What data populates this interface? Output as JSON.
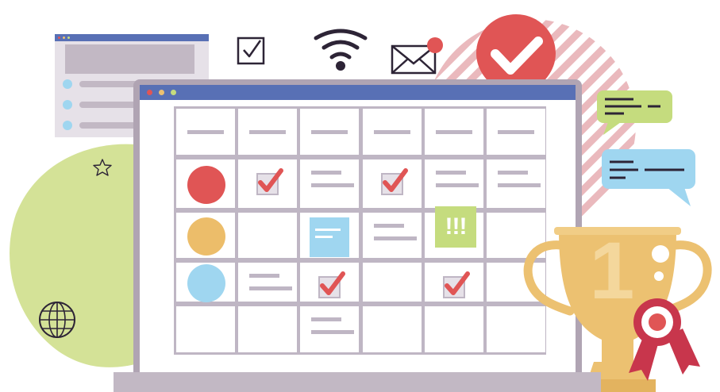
{
  "illustration": {
    "icons": [
      "checkbox-icon",
      "wifi-icon",
      "envelope-icon",
      "notification-dot",
      "location-pin-check-icon",
      "star-outline-icon",
      "globe-icon",
      "chat-bubble-green-icon",
      "chat-bubble-blue-icon",
      "trophy-icon",
      "award-ribbon-icon"
    ],
    "trophy_text": "1",
    "alert_text": "!!!",
    "colors": {
      "laptop_frame": "#b0a4b3",
      "titlebar": "#5870b5",
      "grid_lines": "#bfb6c4",
      "check_red": "#e05555",
      "sticky_blue": "#9fd6f0",
      "sticky_green": "#c5dc7e",
      "green_blob": "#d4e297",
      "stripes": "#eab9bd",
      "trophy_gold": "#ecc171",
      "dot_red": "#e05555",
      "dot_orange": "#ecbd6a",
      "dot_blue": "#9fd6f0"
    }
  },
  "calendar": {
    "header_columns": 6,
    "rows": [
      {
        "row_dot": "red",
        "cells": [
          "checked",
          "lines",
          "checked",
          "lines",
          "lines"
        ]
      },
      {
        "row_dot": "orange",
        "cells": [
          "empty",
          "sticky-note",
          "lines",
          "alert-note",
          "empty"
        ]
      },
      {
        "row_dot": "blue",
        "cells": [
          "lines",
          "checked",
          "empty",
          "checked",
          "empty"
        ]
      },
      {
        "row_dot": "none",
        "cells": [
          "empty",
          "lines",
          "empty",
          "empty",
          "empty"
        ]
      }
    ]
  }
}
